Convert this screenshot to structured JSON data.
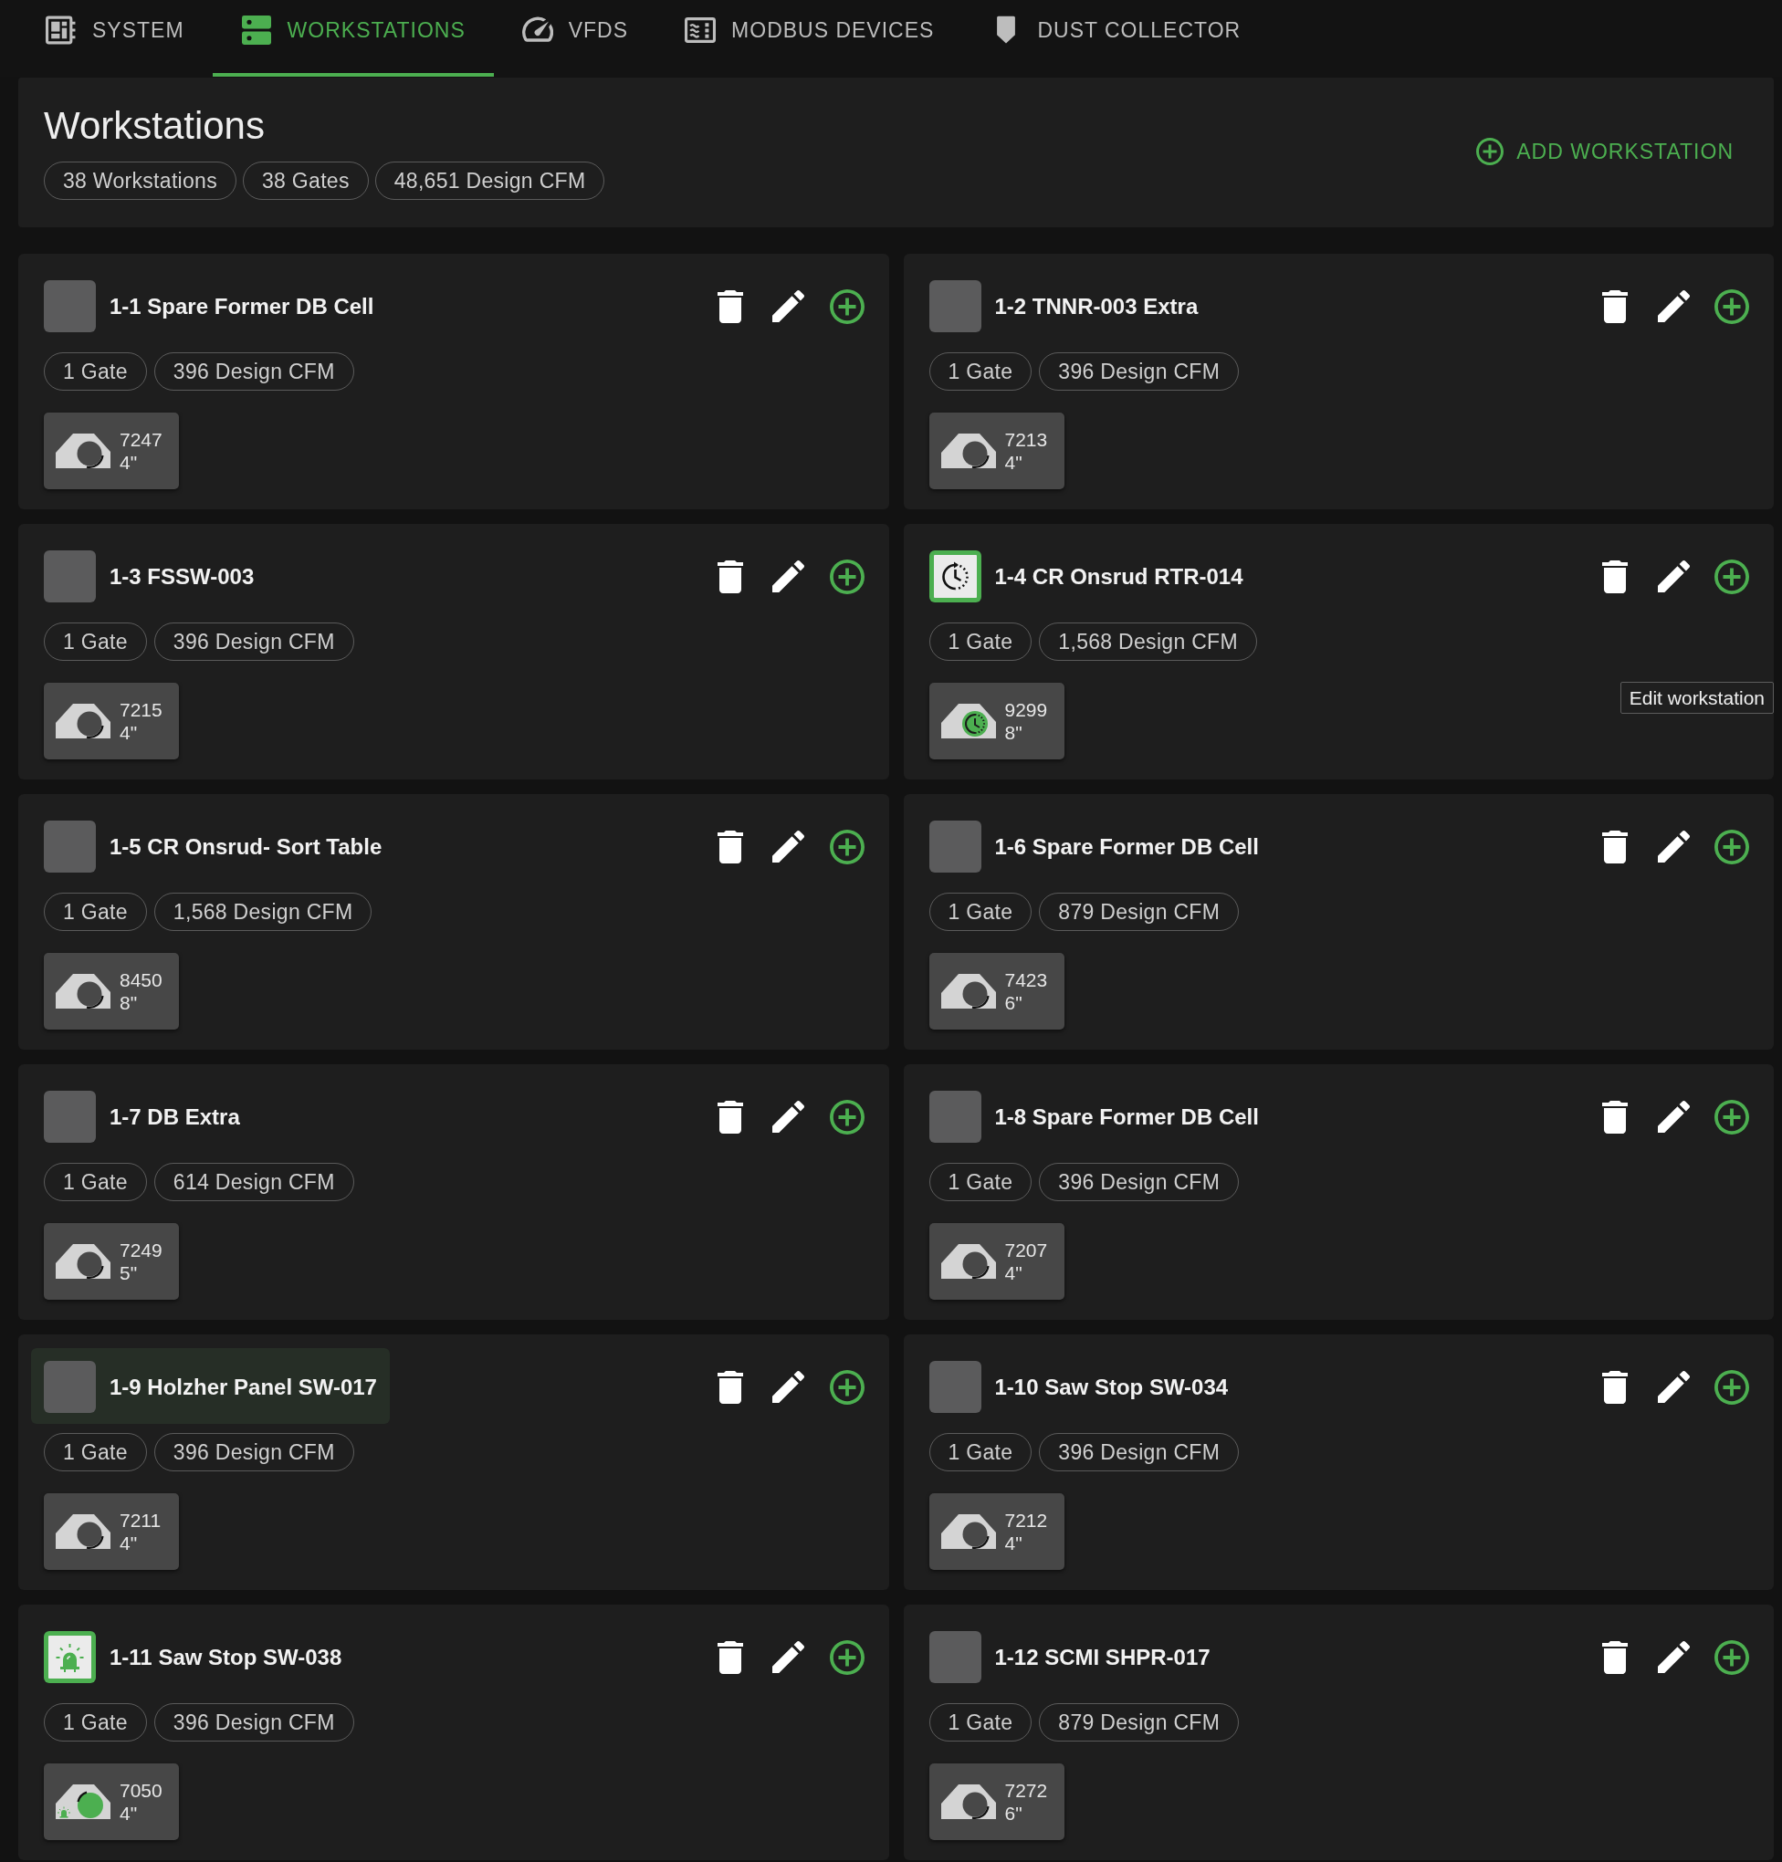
{
  "tabs": [
    {
      "label": "SYSTEM",
      "selected": false
    },
    {
      "label": "WORKSTATIONS",
      "selected": true
    },
    {
      "label": "VFDS",
      "selected": false
    },
    {
      "label": "MODBUS DEVICES",
      "selected": false
    },
    {
      "label": "DUST COLLECTOR",
      "selected": false
    }
  ],
  "header": {
    "title": "Workstations",
    "stats": [
      "38 Workstations",
      "38 Gates",
      "48,651 Design CFM"
    ],
    "add_button": "ADD WORKSTATION"
  },
  "workstations": [
    {
      "name": "1-1 Spare Former DB Cell",
      "kind": "plain",
      "highlighted": false,
      "chips": [
        "1 Gate",
        "396 Design CFM"
      ],
      "gate": {
        "kind": "closed",
        "number": "7247",
        "size": "4\""
      }
    },
    {
      "name": "1-2 TNNR-003 Extra",
      "kind": "plain",
      "highlighted": false,
      "chips": [
        "1 Gate",
        "396 Design CFM"
      ],
      "gate": {
        "kind": "closed",
        "number": "7213",
        "size": "4\""
      }
    },
    {
      "name": "1-3 FSSW-003",
      "kind": "plain",
      "highlighted": false,
      "chips": [
        "1 Gate",
        "396 Design CFM"
      ],
      "gate": {
        "kind": "closed",
        "number": "7215",
        "size": "4\""
      }
    },
    {
      "name": "1-4 CR Onsrud RTR-014",
      "kind": "timer",
      "highlighted": false,
      "chips": [
        "1 Gate",
        "1,568 Design CFM"
      ],
      "gate": {
        "kind": "timer",
        "number": "9299",
        "size": "8\""
      },
      "tooltip": "Edit workstation"
    },
    {
      "name": "1-5 CR Onsrud- Sort Table",
      "kind": "plain",
      "highlighted": false,
      "chips": [
        "1 Gate",
        "1,568 Design CFM"
      ],
      "gate": {
        "kind": "closed",
        "number": "8450",
        "size": "8\""
      }
    },
    {
      "name": "1-6 Spare Former DB Cell",
      "kind": "plain",
      "highlighted": false,
      "chips": [
        "1 Gate",
        "879 Design CFM"
      ],
      "gate": {
        "kind": "closed",
        "number": "7423",
        "size": "6\""
      }
    },
    {
      "name": "1-7 DB Extra",
      "kind": "plain",
      "highlighted": false,
      "chips": [
        "1 Gate",
        "614 Design CFM"
      ],
      "gate": {
        "kind": "closed",
        "number": "7249",
        "size": "5\""
      }
    },
    {
      "name": "1-8 Spare Former DB Cell",
      "kind": "plain",
      "highlighted": false,
      "chips": [
        "1 Gate",
        "396 Design CFM"
      ],
      "gate": {
        "kind": "closed",
        "number": "7207",
        "size": "4\""
      }
    },
    {
      "name": "1-9 Holzher Panel SW-017",
      "kind": "plain",
      "highlighted": true,
      "chips": [
        "1 Gate",
        "396 Design CFM"
      ],
      "gate": {
        "kind": "closed",
        "number": "7211",
        "size": "4\""
      }
    },
    {
      "name": "1-10 Saw Stop SW-034",
      "kind": "plain",
      "highlighted": false,
      "chips": [
        "1 Gate",
        "396 Design CFM"
      ],
      "gate": {
        "kind": "closed",
        "number": "7212",
        "size": "4\""
      }
    },
    {
      "name": "1-11 Saw Stop SW-038",
      "kind": "beacon",
      "highlighted": false,
      "chips": [
        "1 Gate",
        "396 Design CFM"
      ],
      "gate": {
        "kind": "beacon",
        "number": "7050",
        "size": "4\""
      }
    },
    {
      "name": "1-12 SCMI SHPR-017",
      "kind": "plain",
      "highlighted": false,
      "chips": [
        "1 Gate",
        "879 Design CFM"
      ],
      "gate": {
        "kind": "closed",
        "number": "7272",
        "size": "6\""
      }
    }
  ]
}
